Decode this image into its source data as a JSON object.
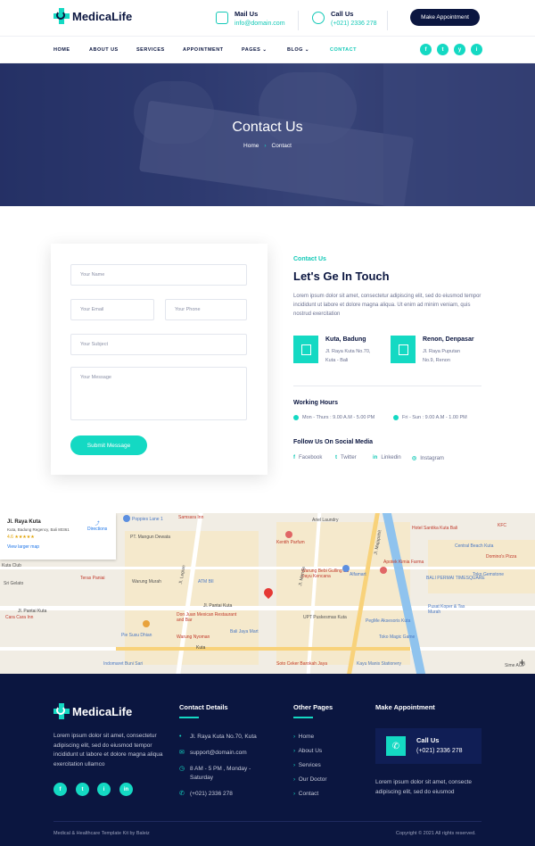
{
  "brand": {
    "name": "MedicaLife"
  },
  "header": {
    "mail": {
      "title": "Mail Us",
      "value": "info@domain.com"
    },
    "call": {
      "title": "Call Us",
      "value": "(+021) 2336 278"
    },
    "cta": "Make Appointment"
  },
  "nav": {
    "items": [
      "HOME",
      "ABOUT US",
      "SERVICES",
      "APPOINTMENT",
      "PAGES",
      "BLOG",
      "CONTACT"
    ],
    "active": "CONTACT",
    "social": [
      "f",
      "t",
      "y",
      "i"
    ]
  },
  "hero": {
    "title": "Contact Us",
    "crumb_home": "Home",
    "crumb_current": "Contact"
  },
  "form": {
    "name_placeholder": "Your Name",
    "email_placeholder": "Your Email",
    "phone_placeholder": "Your Phone",
    "subject_placeholder": "Your Subject",
    "message_placeholder": "Your Message",
    "submit": "Submit Message"
  },
  "info": {
    "tag": "Contact Us",
    "heading": "Let's Ge In Touch",
    "text": "Lorem ipsum dolor sit amet, consectetur adipiscing elit, sed do eiusmod tempor incididunt ut labore et dolore magna aliqua. Ut enim ad minim veniam, quis nostrud exercitation",
    "locations": [
      {
        "title": "Kuta, Badung",
        "line1": "Jl. Raya Kuta No.70,",
        "line2": "Kuta - Bali"
      },
      {
        "title": "Renon, Denpasar",
        "line1": "Jl. Raya Puputan",
        "line2": "No.9, Renon"
      }
    ],
    "hours_title": "Working Hours",
    "hours": [
      "Mon - Thurs : 9.00 A.M - 5.00 PM",
      "Fri - Sun : 9.00 A.M - 1.00 PM"
    ],
    "social_title": "Follow Us On Social Media",
    "social": [
      "Facebook",
      "Twitter",
      "Linkedin",
      "Instagram"
    ]
  },
  "map": {
    "card_title": "Jl. Raya Kuta",
    "card_address": "Kuta, Badung Regency, Bali 80361",
    "rating": "4.6",
    "stars": "★★★★★",
    "directions": "Directions",
    "larger": "View larger map",
    "labels": [
      "Poppies Lane 1",
      "Samsara Inn",
      "Ariel Laundry",
      "Hotel Santika Kuta Bali",
      "KFC",
      "PT. Mangun Dewata",
      "Kentih Parfum",
      "Central Beach Kuta",
      "Domino's Pizza",
      "Teras Paniai",
      "Warung Bebi Gulling Bu Dayu Kencana",
      "Alfamart",
      "Apotek Kimia Farma",
      "BALI PERMAI TIMESQUARE",
      "Toko Gemstone",
      "Warung Murah",
      "ATM BII",
      "Jl. Pantai Kuta",
      "Jl. Pantai Kuta",
      "Don Juan Mexican Restaurant and Bar",
      "UPT Puskesmas Kuta",
      "PegMe Aksesoris Kuta",
      "Pusat Koper & Tas Murah",
      "Pie Susu Dhian",
      "Warung Nyoman",
      "Bali Jaya Mart",
      "Toko Magic Game",
      "Indomaret Buni Sari",
      "Soto Ceker Barokah Jaya",
      "Kayu Manis Stationery",
      "Jl. Legian",
      "Jl. Maruta",
      "Jl. Majapahit",
      "Kuta Club",
      "Sri Gelato",
      "Cara Cara Inn",
      "Kuta",
      "Sime AGP"
    ]
  },
  "footer": {
    "about": "Lorem ipsum dolor sit amet, consectetur adipiscing elit, sed do eiusmod tempor incididunt ut labore et dolore magna aliqua exercitation ullamco",
    "contact_title": "Contact Details",
    "contact": [
      "Jl. Raya Kuta No.70, Kuta",
      "support@domain.com",
      "8 AM - 5 PM , Monday -",
      "Saturday",
      "(+021) 2336 278"
    ],
    "pages_title": "Other Pages",
    "pages": [
      "Home",
      "About Us",
      "Services",
      "Our Doctor",
      "Contact"
    ],
    "appt_title": "Make Appointment",
    "call_title": "Call Us",
    "call_value": "(+021) 2336 278",
    "appt_text": "Lorem ipsum dolor sit amet, consecte adipiscing elit, sed do eiusmod",
    "credit": "Medical & Healthcare Template Kit by Baleiz",
    "copyright": "Copyright © 2021 All rights reserved."
  },
  "colors": {
    "accent": "#14d9c3",
    "navy": "#0b1640"
  }
}
